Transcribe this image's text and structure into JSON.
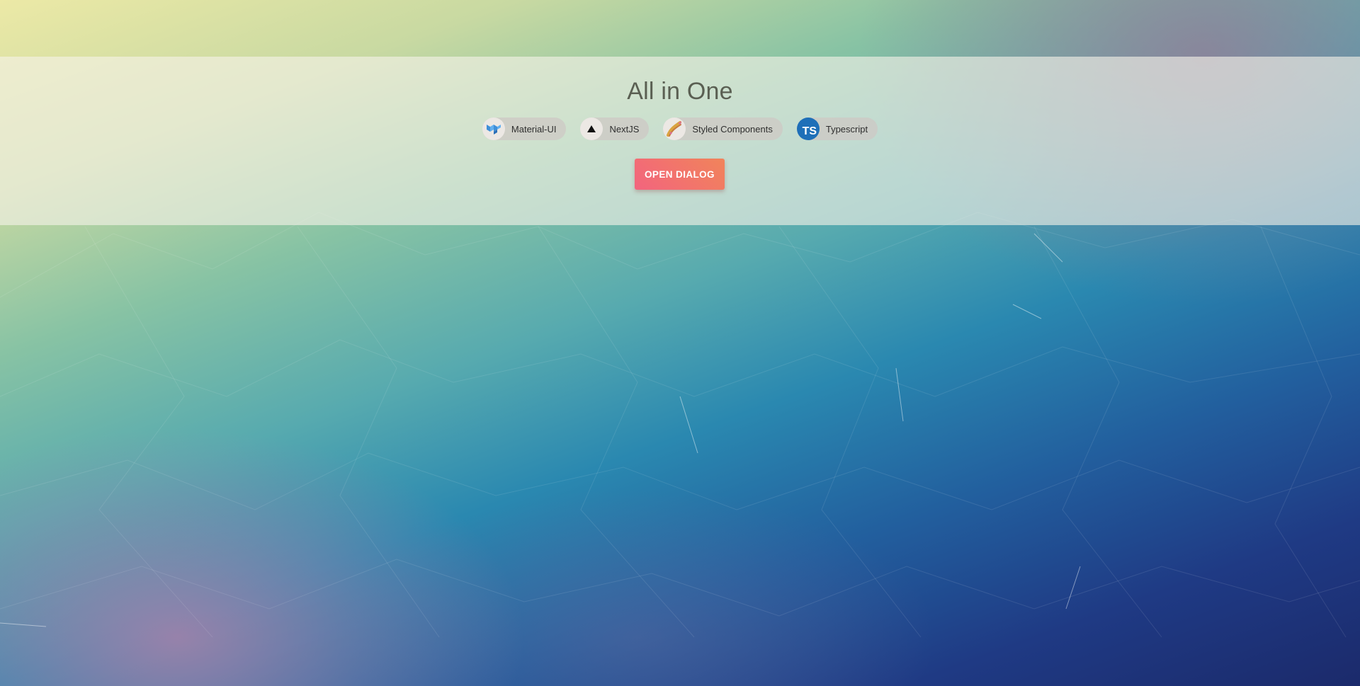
{
  "header": {
    "title": "All in One"
  },
  "chips": [
    {
      "label": "Material-UI",
      "icon": "material-ui-icon"
    },
    {
      "label": "NextJS",
      "icon": "nextjs-triangle-icon"
    },
    {
      "label": "Styled Components",
      "icon": "styled-components-icon"
    },
    {
      "label": "Typescript",
      "icon": "typescript-icon",
      "icon_text": "TS"
    }
  ],
  "actions": {
    "open_dialog_label": "OPEN DIALOG"
  },
  "colors": {
    "button_gradient_start": "#f2647e",
    "button_gradient_end": "#f1845a",
    "typescript_blue": "#1e6fb8",
    "title_color": "#5a5f52"
  }
}
